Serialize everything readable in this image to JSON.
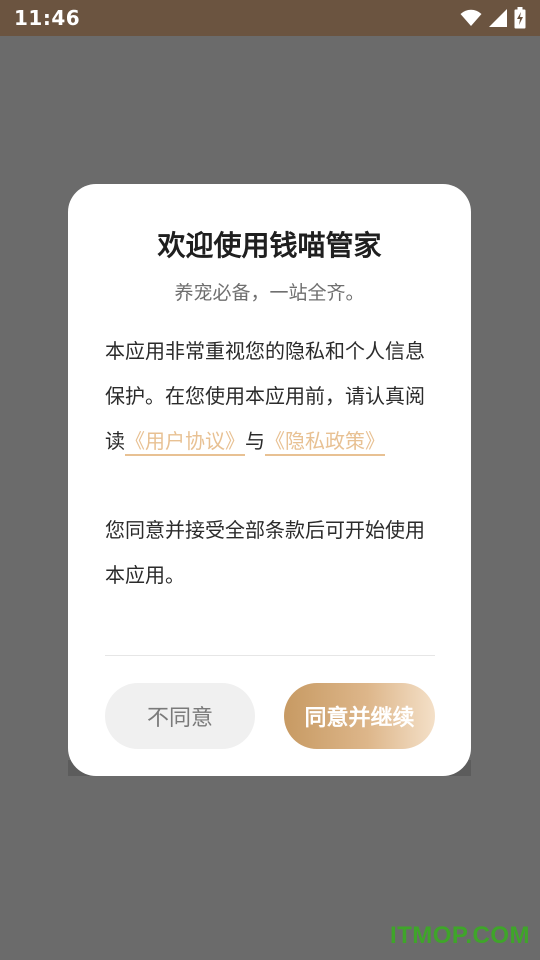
{
  "status_bar": {
    "time": "11:46",
    "icons": [
      "wifi-icon",
      "signal-icon",
      "battery-charging-icon"
    ]
  },
  "dialog": {
    "title": "欢迎使用钱喵管家",
    "subtitle": "养宠必备，一站全齐。",
    "body": {
      "paragraph1_prefix": "本应用非常重视您的隐私和个人信息保护。在您使用本应用前，请认真阅读",
      "user_agreement_link": "《用户协议》",
      "connector": "与",
      "privacy_policy_link": "《隐私政策》",
      "paragraph2": "您同意并接受全部条款后可开始使用本应用。"
    },
    "buttons": {
      "disagree_label": "不同意",
      "agree_label": "同意并继续"
    }
  },
  "watermark": "ITMOP.COM",
  "colors": {
    "status_bar_bg": "#6b5440",
    "overlay_bg": "#6b6b6b",
    "link": "#e8c193",
    "agree_gradient_start": "#c79a63",
    "agree_gradient_end": "#f4e0c8",
    "watermark": "#3fa52a"
  }
}
